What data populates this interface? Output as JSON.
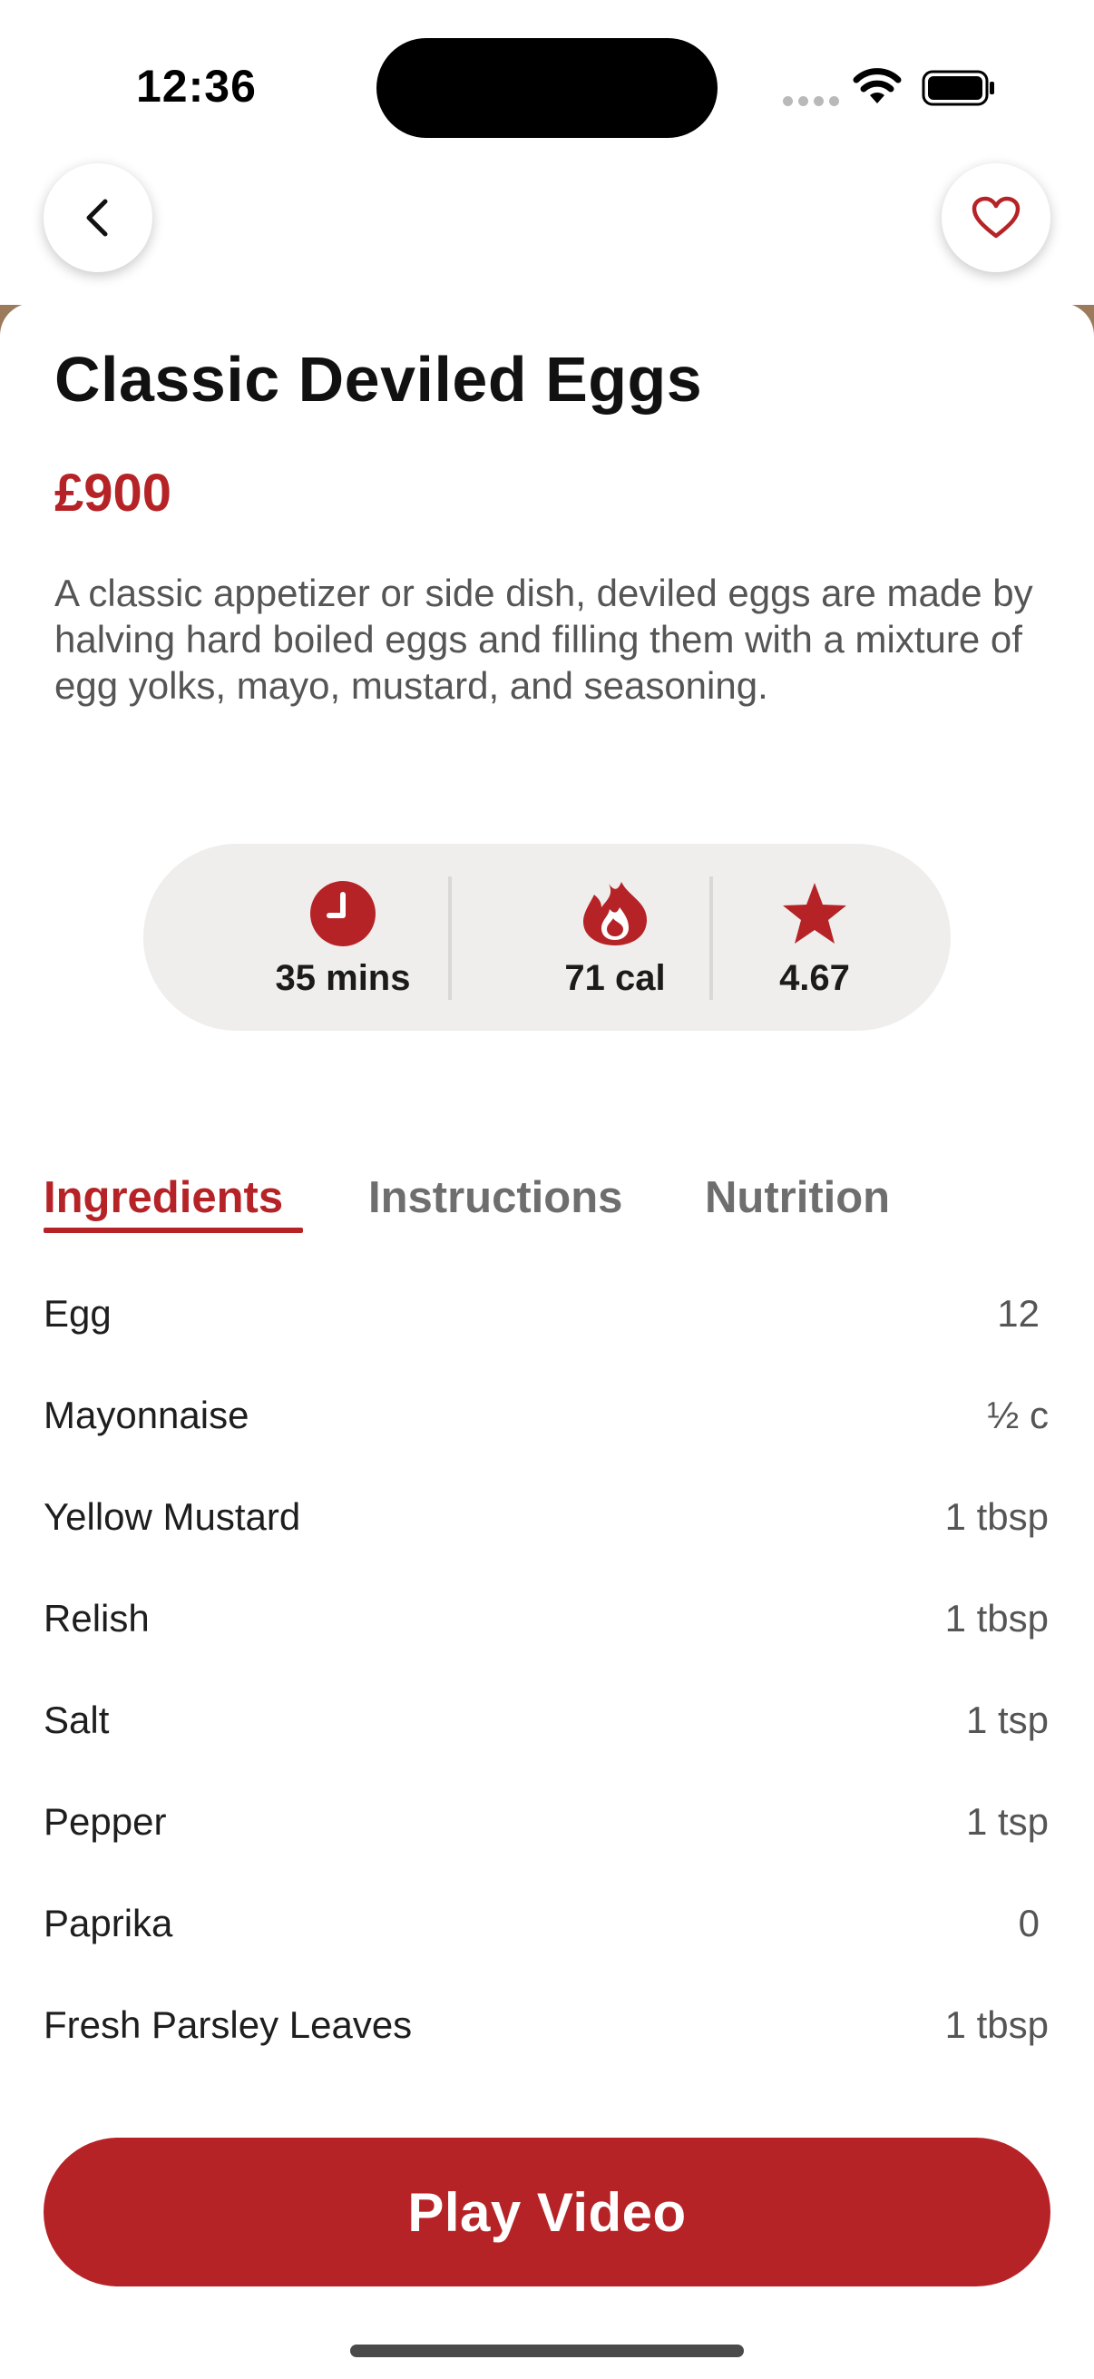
{
  "status_bar": {
    "time": "12:36"
  },
  "header": {
    "back_icon": "chevron-left-icon",
    "favorite_icon": "heart-outline-icon"
  },
  "recipe": {
    "title": "Classic Deviled Eggs",
    "price": "£900",
    "description": "A classic appetizer or side dish, deviled eggs are made by halving hard boiled eggs and filling them with a mixture of egg yolks, mayo, mustard, and seasoning."
  },
  "stats": {
    "time": "35 mins",
    "calories": "71 cal",
    "rating": "4.67",
    "icons": [
      "clock-icon",
      "flame-icon",
      "star-icon"
    ]
  },
  "tabs": [
    {
      "label": "Ingredients",
      "active": true
    },
    {
      "label": "Instructions",
      "active": false
    },
    {
      "label": "Nutrition",
      "active": false
    }
  ],
  "ingredients": [
    {
      "name": "Egg",
      "qty": "12"
    },
    {
      "name": "Mayonnaise",
      "qty": "½ c"
    },
    {
      "name": "Yellow Mustard",
      "qty": "1 tbsp"
    },
    {
      "name": "Relish",
      "qty": "1 tbsp"
    },
    {
      "name": "Salt",
      "qty": "1 tsp"
    },
    {
      "name": "Pepper",
      "qty": "1 tsp"
    },
    {
      "name": "Paprika",
      "qty": "0"
    },
    {
      "name": "Fresh Parsley Leaves",
      "qty": "1 tbsp"
    }
  ],
  "actions": {
    "play_video": "Play Video"
  },
  "colors": {
    "accent": "#b62327",
    "pill_background": "#efeeed"
  }
}
